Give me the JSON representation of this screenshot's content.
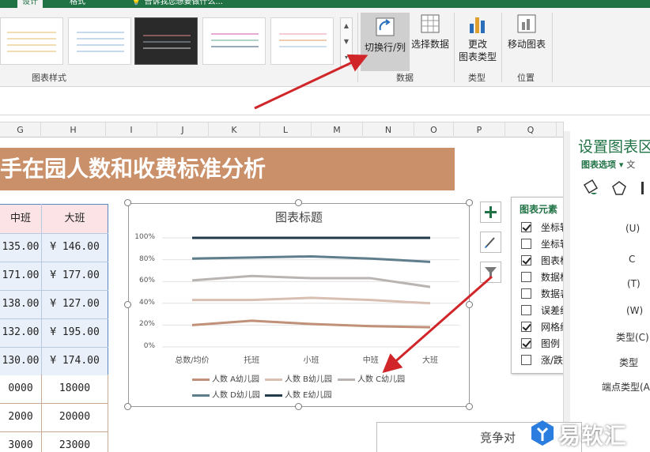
{
  "ribbon": {
    "tabs": [
      "设计",
      "格式"
    ],
    "search": "告诉我您想要做什么...",
    "groups": {
      "styles": "图表样式",
      "data": "数据",
      "type": "类型",
      "location": "位置"
    },
    "buttons": {
      "switch_row_col": "切换行/列",
      "select_data": "选择数据",
      "change_type_1": "更改",
      "change_type_2": "图表类型",
      "move_chart": "移动图表"
    }
  },
  "sheet": {
    "columns": [
      "G",
      "H",
      "I",
      "J",
      "K",
      "L",
      "M",
      "N",
      "O",
      "P",
      "Q"
    ],
    "title": "手在园人数和收费标准分析",
    "table_headers": [
      "中班",
      "大班"
    ],
    "fee_rows": [
      [
        "135.00",
        "¥  146.00"
      ],
      [
        "171.00",
        "¥  177.00"
      ],
      [
        "138.00",
        "¥  127.00"
      ],
      [
        "132.00",
        "¥  195.00"
      ],
      [
        "130.00",
        "¥  174.00"
      ]
    ],
    "count_rows": [
      [
        "0000",
        "18000"
      ],
      [
        "2000",
        "20000"
      ],
      [
        "3000",
        "23000"
      ]
    ],
    "bottom_text": "竞争对"
  },
  "chart_data": {
    "type": "line",
    "title": "图表标题",
    "categories": [
      "总数/均价",
      "托班",
      "小班",
      "中班",
      "大班"
    ],
    "y_ticks": [
      "100%",
      "80%",
      "60%",
      "40%",
      "20%",
      "0%"
    ],
    "ylim": [
      0,
      1
    ],
    "stacked": true,
    "grid": true,
    "legend_position": "bottom",
    "series": [
      {
        "name": "人数 A幼儿园",
        "values": [
          0.2,
          0.24,
          0.21,
          0.19,
          0.18
        ],
        "color": "#c09078"
      },
      {
        "name": "人数 B幼儿园",
        "values": [
          0.43,
          0.43,
          0.45,
          0.43,
          0.4
        ],
        "color": "#d9bfb2"
      },
      {
        "name": "人数 C幼儿园",
        "values": [
          0.61,
          0.65,
          0.63,
          0.63,
          0.55
        ],
        "color": "#b9b4b1"
      },
      {
        "name": "人数 D幼儿园",
        "values": [
          0.81,
          0.82,
          0.83,
          0.81,
          0.78
        ],
        "color": "#5e7e8c"
      },
      {
        "name": "人数 E幼儿园",
        "values": [
          1.0,
          1.0,
          1.0,
          1.0,
          1.0
        ],
        "color": "#223a4a"
      }
    ]
  },
  "chart_elements": {
    "title": "图表元素",
    "items": [
      {
        "label": "坐标轴",
        "checked": true
      },
      {
        "label": "坐标轴标题",
        "checked": false
      },
      {
        "label": "图表标题",
        "checked": true
      },
      {
        "label": "数据标签",
        "checked": false
      },
      {
        "label": "数据表",
        "checked": false
      },
      {
        "label": "误差线",
        "checked": false
      },
      {
        "label": "网格线",
        "checked": true
      },
      {
        "label": "图例",
        "checked": true
      },
      {
        "label": "涨/跌柱线",
        "checked": false
      }
    ]
  },
  "format_pane": {
    "title": "设置图表区",
    "tab": "图表选项",
    "tab_more": "文",
    "fragments": [
      "(U)",
      "C",
      "(T)",
      "(W)",
      "类型(C)",
      "类型",
      "端点类型(A)"
    ]
  },
  "watermark": "易软汇",
  "colors": {
    "excel_green": "#217346",
    "banner": "#c9906a",
    "arrow": "#d0262a"
  }
}
